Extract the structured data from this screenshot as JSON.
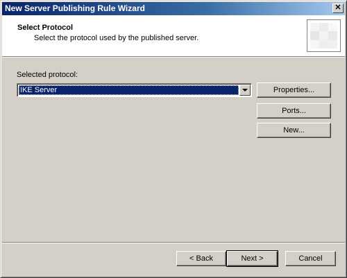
{
  "window": {
    "title": "New Server Publishing Rule Wizard",
    "close_glyph": "✕"
  },
  "header": {
    "title": "Select Protocol",
    "subtitle": "Select the protocol used by the published server.",
    "icon": "wizard-graphic-icon"
  },
  "form": {
    "protocol_label": "Selected protocol:",
    "protocol_value": "IKE Server"
  },
  "side_buttons": {
    "properties": "Properties...",
    "ports": "Ports...",
    "new": "New..."
  },
  "footer": {
    "back": "< Back",
    "next": "Next >",
    "cancel": "Cancel"
  },
  "colors": {
    "titlebar_start": "#0a246a",
    "face": "#d4d0c8",
    "selection": "#0a246a"
  }
}
